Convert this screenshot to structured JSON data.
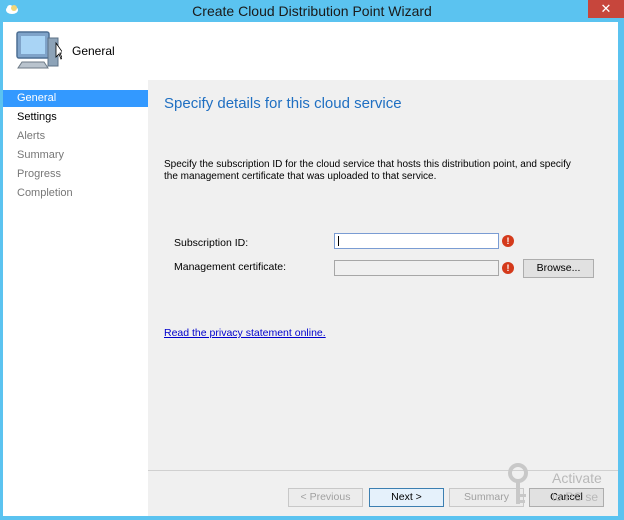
{
  "window": {
    "title": "Create Cloud Distribution Point Wizard",
    "close_label": "✕"
  },
  "header": {
    "page_name": "General",
    "icon": "computer-monitor-icon"
  },
  "nav": {
    "items": [
      {
        "label": "General",
        "state": "active"
      },
      {
        "label": "Settings",
        "state": "done"
      },
      {
        "label": "Alerts",
        "state": "pending"
      },
      {
        "label": "Summary",
        "state": "pending"
      },
      {
        "label": "Progress",
        "state": "pending"
      },
      {
        "label": "Completion",
        "state": "pending"
      }
    ]
  },
  "main": {
    "heading": "Specify details for this cloud service",
    "description": "Specify the subscription ID for the cloud service that hosts this distribution point, and specify the management certificate that was uploaded to that service.",
    "subscription": {
      "label": "Subscription ID:",
      "value": ""
    },
    "certificate": {
      "label": "Management certificate:",
      "value": "",
      "browse_label": "Browse..."
    },
    "privacy_link": "Read the privacy statement online.",
    "error_glyph": "!"
  },
  "footer": {
    "previous_label": "< Previous",
    "next_label": "Next >",
    "summary_label": "Summary",
    "cancel_label": "Cancel"
  },
  "watermark": {
    "title": "Activate",
    "subtitle": "to PC se"
  },
  "colors": {
    "title_bar": "#5bc3f0",
    "nav_active": "#3399ff",
    "heading": "#1f6fc2",
    "error": "#d43a1b",
    "link": "#0000cc"
  }
}
